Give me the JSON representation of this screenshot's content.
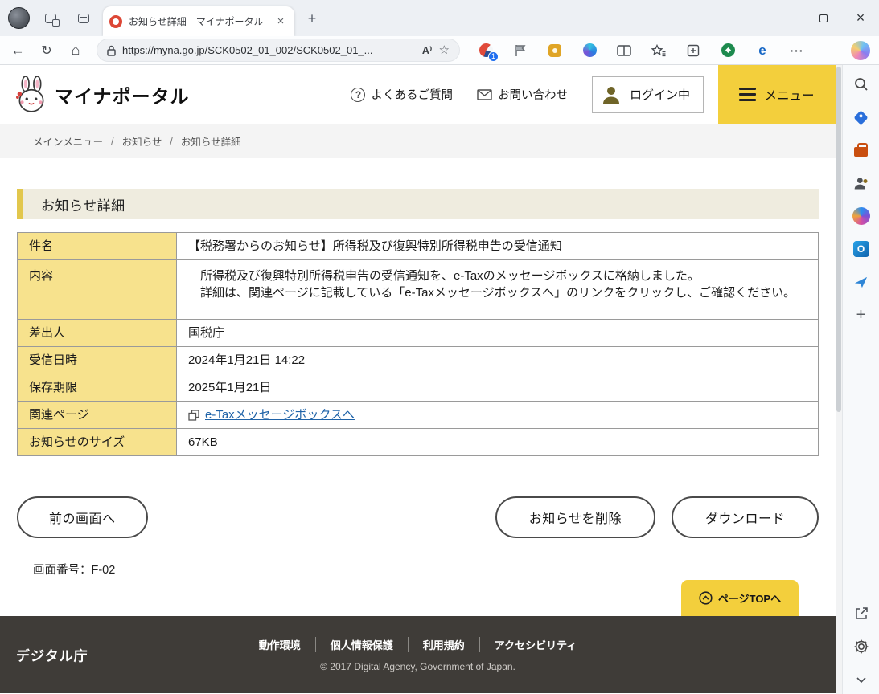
{
  "browser": {
    "tab_title": "お知らせ詳細｜マイナポータル",
    "url": "https://myna.go.jp/SCK0502_01_002/SCK0502_01_...",
    "extension_badge": "1"
  },
  "header": {
    "brand": "マイナポータル",
    "faq_label": "よくあるご質問",
    "contact_label": "お問い合わせ",
    "login_status": "ログイン中",
    "menu_label": "メニュー"
  },
  "breadcrumb": {
    "items": [
      "メインメニュー",
      "お知らせ",
      "お知らせ詳細"
    ],
    "separator": "/"
  },
  "page": {
    "title": "お知らせ詳細",
    "table": {
      "rows": [
        {
          "label": "件名",
          "value": "【税務署からのお知らせ】所得税及び復興特別所得税申告の受信通知"
        },
        {
          "label": "内容",
          "line1": "　所得税及び復興特別所得税申告の受信通知を、e-Taxのメッセージボックスに格納しました。",
          "line2": "　詳細は、関連ページに記載している「e-Taxメッセージボックスへ」のリンクをクリックし、ご確認ください。"
        },
        {
          "label": "差出人",
          "value": "国税庁"
        },
        {
          "label": "受信日時",
          "value": "2024年1月21日 14:22"
        },
        {
          "label": "保存期限",
          "value": "2025年1月21日"
        },
        {
          "label": "関連ページ",
          "value": "e-Taxメッセージボックスへ"
        },
        {
          "label": "お知らせのサイズ",
          "value": "67KB"
        }
      ]
    },
    "buttons": {
      "back": "前の画面へ",
      "delete": "お知らせを削除",
      "download": "ダウンロード",
      "page_top": "ページTOPへ"
    },
    "screen_number": "画面番号：F-02"
  },
  "footer": {
    "brand": "デジタル庁",
    "links": [
      "動作環境",
      "個人情報保護",
      "利用規約",
      "アクセシビリティ"
    ],
    "copyright": "© 2017 Digital Agency, Government of Japan."
  },
  "colors": {
    "accent_yellow": "#f3cf3c",
    "label_cell_yellow": "#f7e28d",
    "title_band_beige": "#efecdf",
    "title_accent": "#e2c74d",
    "footer_dark": "#3f3c38",
    "link_blue": "#1f63a8"
  }
}
